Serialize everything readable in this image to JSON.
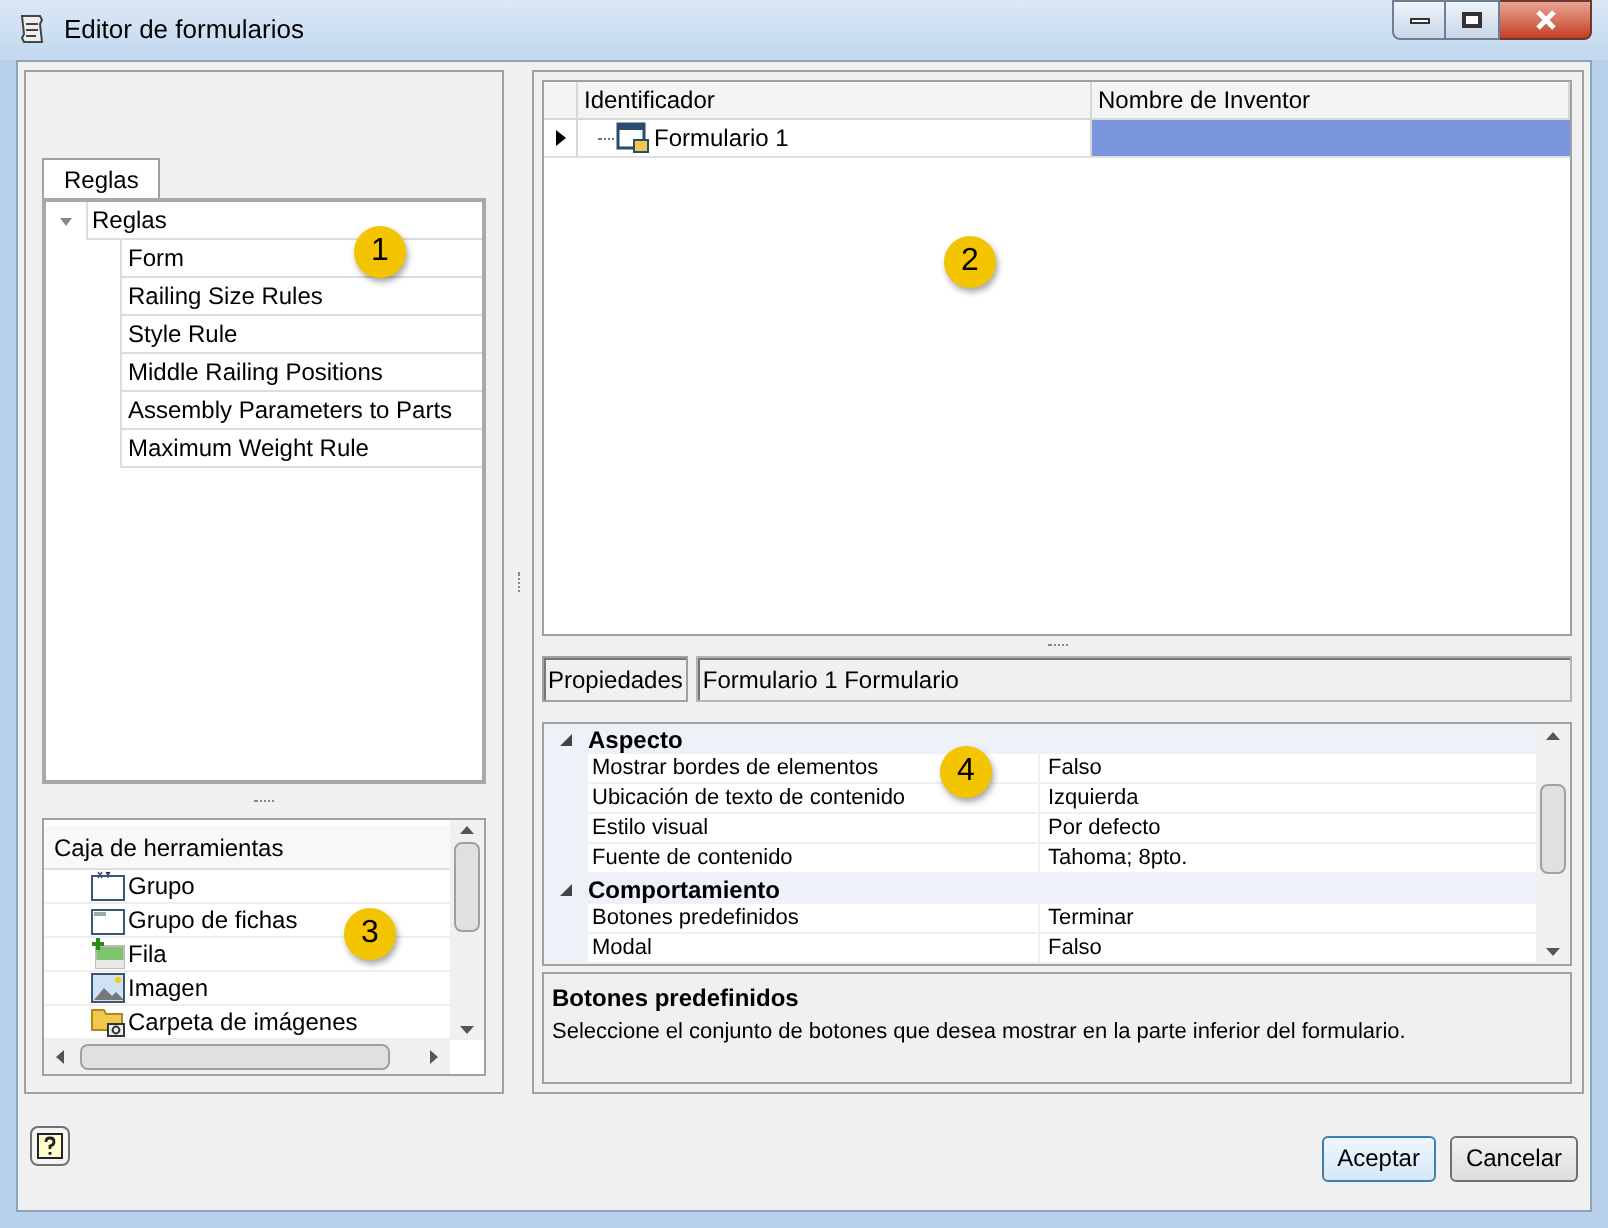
{
  "window": {
    "title": "Editor de formularios"
  },
  "rules_panel": {
    "tabs": [
      {
        "label": "Reglas",
        "selected": true
      }
    ],
    "tree": {
      "label": "Reglas",
      "expanded": true,
      "children": [
        {
          "label": "Form"
        },
        {
          "label": "Railing Size Rules"
        },
        {
          "label": "Style Rule"
        },
        {
          "label": "Middle Railing Positions"
        },
        {
          "label": "Assembly Parameters to Parts"
        },
        {
          "label": "Maximum Weight Rule"
        }
      ]
    },
    "callout": "1"
  },
  "toolbox": {
    "title": "Caja de herramientas",
    "items": [
      {
        "label": "Grupo",
        "kind": "group"
      },
      {
        "label": "Grupo de fichas",
        "kind": "tabs"
      },
      {
        "label": "Fila",
        "kind": "row"
      },
      {
        "label": "Imagen",
        "kind": "image"
      },
      {
        "label": "Carpeta de imágenes",
        "kind": "folder"
      }
    ],
    "callout": "3"
  },
  "form_grid": {
    "columns": [
      "Identificador",
      "Nombre de Inventor"
    ],
    "rows": [
      {
        "identifier": "Formulario 1",
        "selected": true
      }
    ],
    "callout": "2"
  },
  "properties": {
    "label": "Propiedades",
    "object": "Formulario 1 Formulario",
    "callout": "4",
    "categories": [
      {
        "name": "Aspecto",
        "expanded": true,
        "items": [
          {
            "name": "Mostrar bordes de elementos",
            "value": "Falso"
          },
          {
            "name": "Ubicación de texto de contenido",
            "value": "Izquierda"
          },
          {
            "name": "Estilo visual",
            "value": "Por defecto"
          },
          {
            "name": "Fuente de contenido",
            "value": "Tahoma; 8pto."
          }
        ]
      },
      {
        "name": "Comportamiento",
        "expanded": true,
        "items": [
          {
            "name": "Botones predefinidos",
            "value": "Terminar"
          },
          {
            "name": "Modal",
            "value": "Falso"
          }
        ]
      }
    ],
    "description": {
      "title": "Botones predefinidos",
      "text": "Seleccione el conjunto de botones que desea mostrar en la parte inferior del formulario."
    }
  },
  "buttons": [
    {
      "label": "Aceptar",
      "default": true
    },
    {
      "label": "Cancelar",
      "default": false
    }
  ]
}
